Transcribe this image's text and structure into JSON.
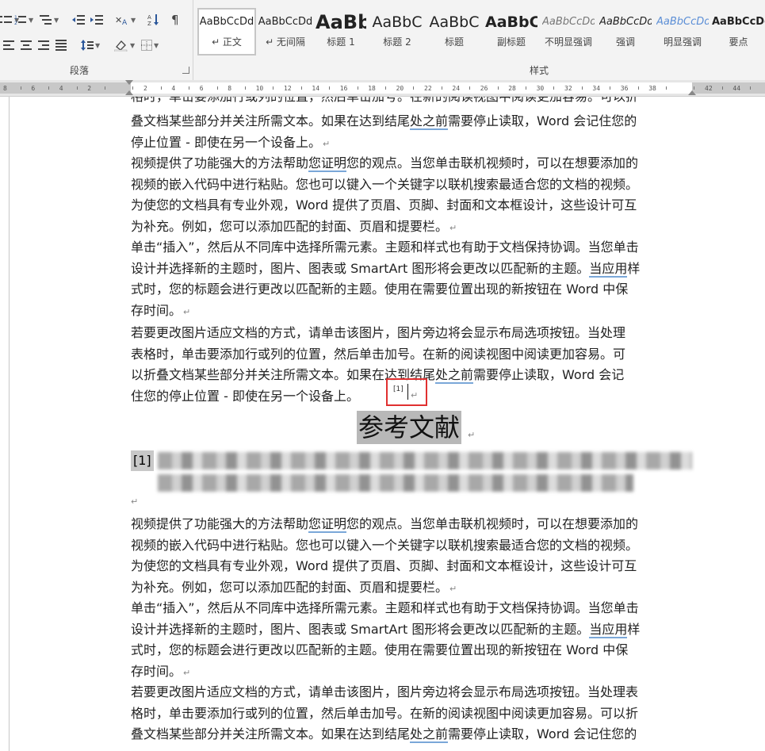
{
  "ribbon": {
    "paragraph_group_label": "段落",
    "styles_group_label": "样式",
    "paragraph_tools": [
      "bullets-icon",
      "numbering-icon",
      "multilevel-list-icon",
      "decrease-indent-icon",
      "increase-indent-icon",
      "chinese-layout-icon",
      "sort-icon",
      "show-marks-icon",
      "align-left-icon",
      "align-center-icon",
      "align-right-icon",
      "justify-icon",
      "distributed-icon",
      "line-spacing-icon",
      "shading-icon",
      "borders-icon"
    ],
    "styles": [
      {
        "sample": "AaBbCcDd",
        "name": "↵ 正文",
        "active": true
      },
      {
        "sample": "AaBbCcDd",
        "name": "↵ 无间隔"
      },
      {
        "sample": "AaBb",
        "name": "标题 1"
      },
      {
        "sample": "AaBbC",
        "name": "标题 2"
      },
      {
        "sample": "AaBbC",
        "name": "标题"
      },
      {
        "sample": "AaBbC",
        "name": "副标题"
      },
      {
        "sample": "AaBbCcDd",
        "name": "不明显强调"
      },
      {
        "sample": "AaBbCcDd",
        "name": "强调"
      },
      {
        "sample": "AaBbCcDd",
        "name": "明显强调"
      },
      {
        "sample": "AaBbCcDd",
        "name": "要点"
      }
    ]
  },
  "ruler": {
    "labels": [
      "8",
      "6",
      "4",
      "2",
      "",
      "2",
      "4",
      "6",
      "8",
      "10",
      "12",
      "14",
      "16",
      "18",
      "20",
      "22",
      "24",
      "26",
      "28",
      "30",
      "32",
      "34",
      "36",
      "38",
      "",
      "42",
      "44"
    ]
  },
  "document": {
    "top_partial": "格时，单击要添加行或列的位置，然后单击加号。在新的阅读视图中阅读更加容易。可以折",
    "p1": [
      "叠文档某些部分并关注所需文本。如果在达到结尾",
      "处之前",
      "需要停止读取，Word 会记住您的",
      "停止位置 - 即使在另一个设备上。"
    ],
    "p2": [
      "视频提供了功能强大的方法帮助",
      "您证明",
      "您的观点。当您单击联机视频时，可以在想要添加的",
      "视频的嵌入代码中进行粘贴。您也可以键入一个关键字以联机搜索最适合您的文档的视频。",
      "为使您的文档具有专业外观，Word 提供了页眉、页脚、封面和文本框设计，这些设计可互",
      "为补充。例如，您可以添加匹配的封面、页眉和提要栏。"
    ],
    "p3": [
      "单击“插入”，然后从不同库中选择所需元素。主题和样式也有助于文档保持协调。当您单击",
      "设计并选择新的主题时，图片、图表或 SmartArt 图形将会更改以匹配新的主题。",
      "当应用",
      "样",
      "式时，您的标题会进行更改以匹配新的主题。使用在需要位置出现的新按钮在 Word 中保",
      "存时间。"
    ],
    "p4": [
      "若要更改图片适应文档的方式，请单击该图片，图片旁边将会显示布局选项按钮。当处理",
      "表格时，单击要添加行或列的位置，然后单击加号。在新的阅读视图中阅读更加容易。可",
      "以折叠文档某些部分并关注所需文本。如果在达到结尾",
      "处之前",
      "需要停止读取，Word 会记",
      "住您的停止位置 - 即使在另一个设备上。"
    ],
    "citation_mark": "[1]",
    "heading": "参考文献",
    "reference_number": "[1]",
    "p5": [
      "视频提供了功能强大的方法帮助",
      "您证明",
      "您的观点。当您单击联机视频时，可以在想要添加的",
      "视频的嵌入代码中进行粘贴。您也可以键入一个关键字以联机搜索最适合您的文档的视频。",
      "为使您的文档具有专业外观，Word 提供了页眉、页脚、封面和文本框设计，这些设计可互",
      "为补充。例如，您可以添加匹配的封面、页眉和提要栏。"
    ],
    "p6": [
      "单击“插入”，然后从不同库中选择所需元素。主题和样式也有助于文档保持协调。当您单击",
      "设计并选择新的主题时，图片、图表或 SmartArt 图形将会更改以匹配新的主题。",
      "当应用",
      "样",
      "式时，您的标题会进行更改以匹配新的主题。使用在需要位置出现的新按钮在 Word 中保",
      "存时间。"
    ],
    "p7": [
      "若要更改图片适应文档的方式，请单击该图片，图片旁边将会显示布局选项按钮。当处理表",
      "格时，单击要添加行或列的位置，然后单击加号。在新的阅读视图中阅读更加容易。可以折",
      "叠文档某些部分并关注所需文本。如果在达到结尾",
      "处之前",
      "需要停止读取，Word 会记住您的"
    ]
  },
  "colors": {
    "accent_underline": "#7aa7d8",
    "highlight_box": "#e03030"
  }
}
